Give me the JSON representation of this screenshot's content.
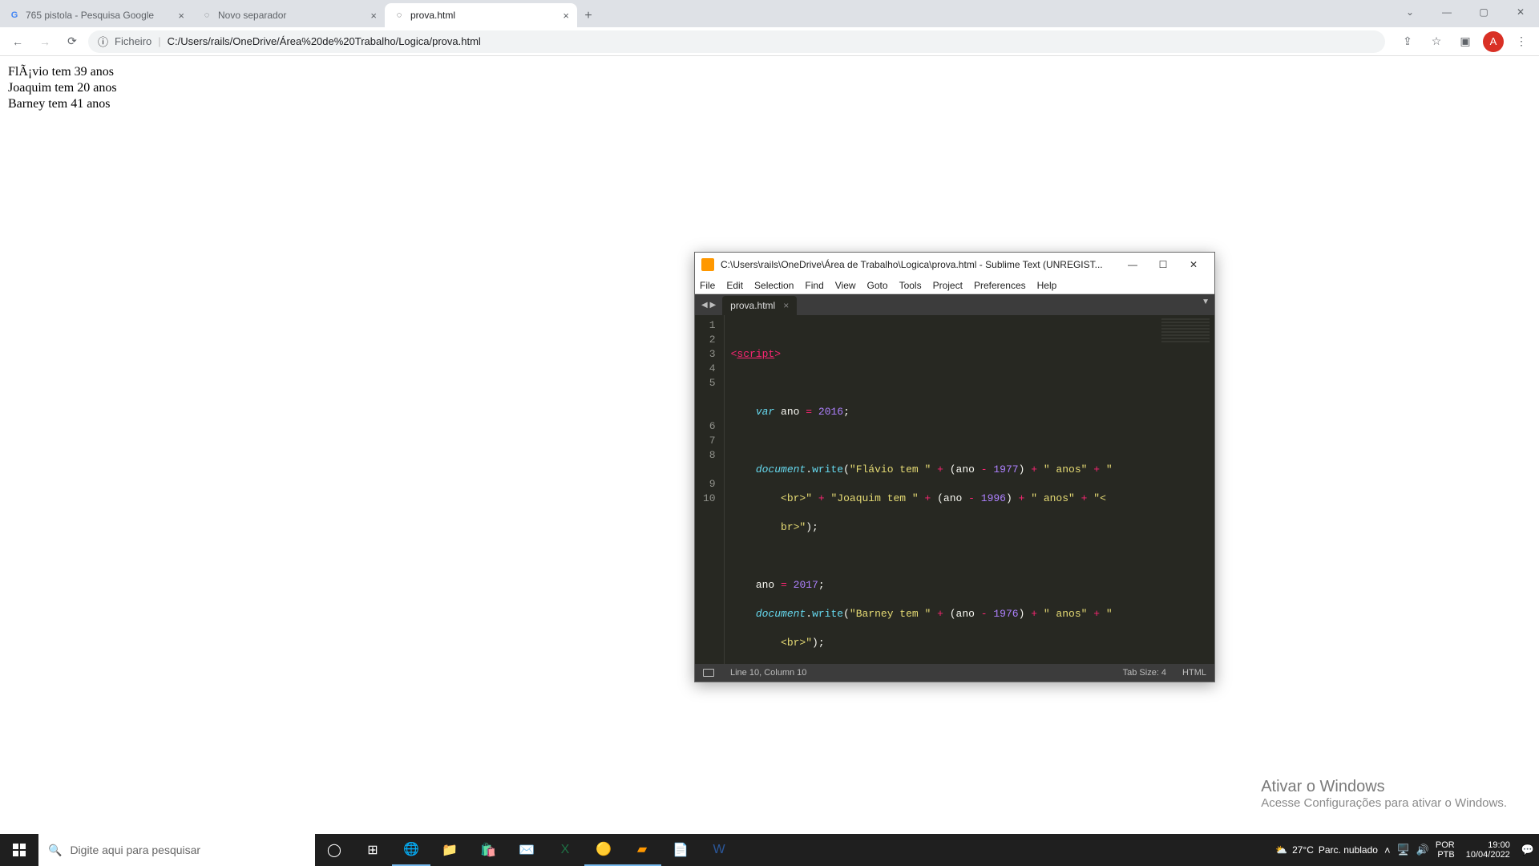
{
  "browser": {
    "tabs": [
      {
        "title": "765 pistola - Pesquisa Google",
        "favicon": "G",
        "closeable": true,
        "active": false
      },
      {
        "title": "Novo separador",
        "favicon": "◌",
        "closeable": true,
        "active": false
      },
      {
        "title": "prova.html",
        "favicon": "◌",
        "closeable": true,
        "active": true
      }
    ],
    "url_scheme": "Ficheiro",
    "url_path": "C:/Users/rails/OneDrive/Área%20de%20Trabalho/Logica/prova.html",
    "avatar_initial": "A",
    "info_icon": "ⓘ",
    "page_lines": [
      "FlÃ¡vio tem 39 anos",
      "Joaquim tem 20 anos",
      "Barney tem 41 anos"
    ]
  },
  "sublime": {
    "title": "C:\\Users\\rails\\OneDrive\\Área de Trabalho\\Logica\\prova.html - Sublime Text (UNREGIST...",
    "menu": [
      "File",
      "Edit",
      "Selection",
      "Find",
      "View",
      "Goto",
      "Tools",
      "Project",
      "Preferences",
      "Help"
    ],
    "tab_name": "prova.html",
    "status_left": "Line 10, Column 10",
    "status_tab": "Tab Size: 4",
    "status_lang": "HTML",
    "line_count": 10
  },
  "watermark": {
    "title": "Ativar o Windows",
    "subtitle": "Acesse Configurações para ativar o Windows."
  },
  "taskbar": {
    "search_placeholder": "Digite aqui para pesquisar",
    "weather_temp": "27°C",
    "weather_cond": "Parc. nublado",
    "lang1": "POR",
    "lang2": "PTB",
    "time": "19:00",
    "date": "10/04/2022"
  }
}
